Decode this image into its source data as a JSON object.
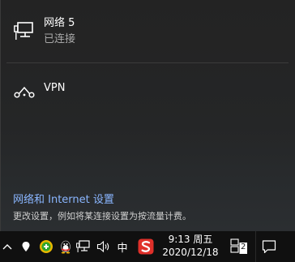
{
  "networks": [
    {
      "name": "网络 5",
      "status": "已连接",
      "icon": "wired-network-icon"
    },
    {
      "name": "VPN",
      "icon": "vpn-icon"
    }
  ],
  "settings": {
    "link_label": "网络和 Internet 设置",
    "description": "更改设置，例如将某连接设置为按流量计费。"
  },
  "taskbar": {
    "time": "9:13 周五",
    "date": "2020/12/18",
    "ime_label": "中",
    "notification_count": "2",
    "colors": {
      "background": "#101010",
      "sogou": "#e0302a",
      "link": "#8ab6ff"
    }
  }
}
